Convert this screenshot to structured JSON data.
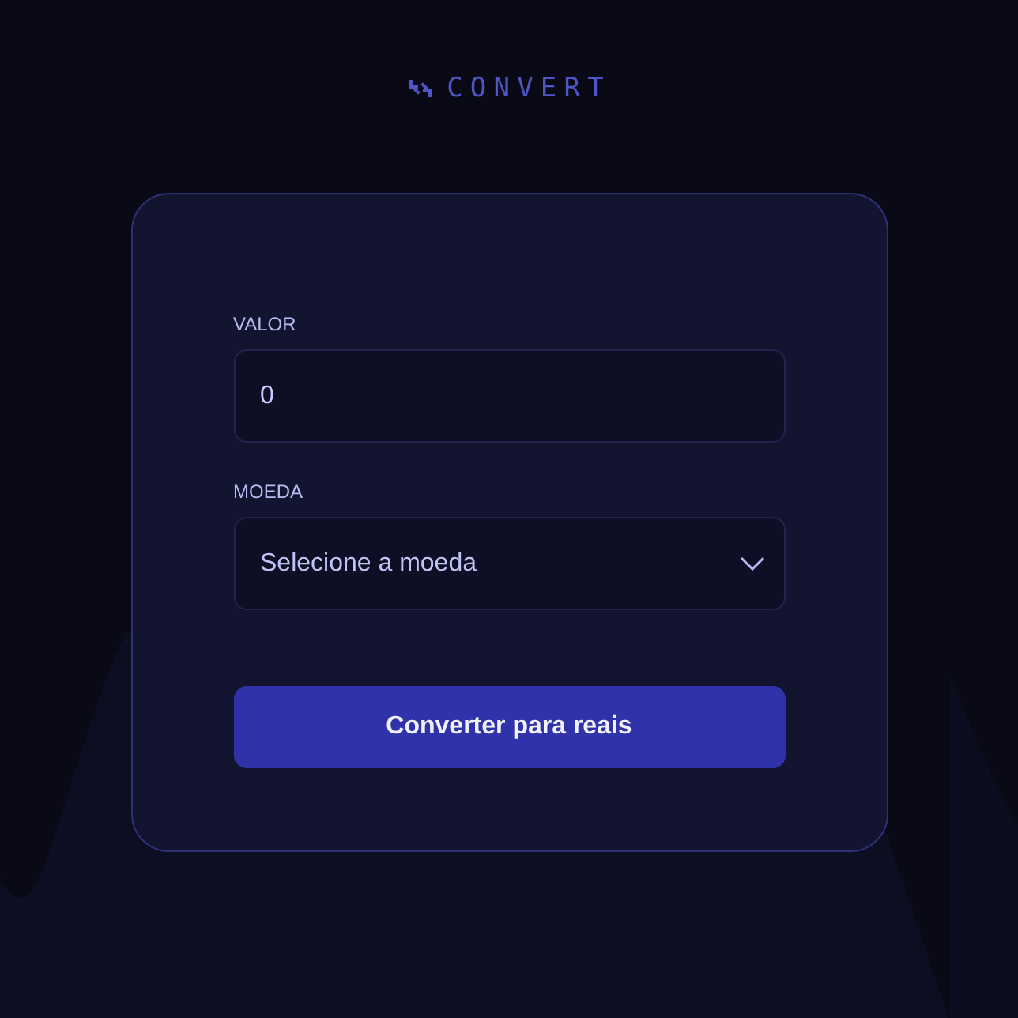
{
  "logo": {
    "text": "CONVERT"
  },
  "form": {
    "fields": [
      {
        "kind": "input",
        "label": "VALOR",
        "value": "0"
      },
      {
        "kind": "select",
        "label": "MOEDA",
        "placeholder": "Selecione a moeda"
      }
    ],
    "submit": {
      "label": "Converter para reais"
    }
  }
}
